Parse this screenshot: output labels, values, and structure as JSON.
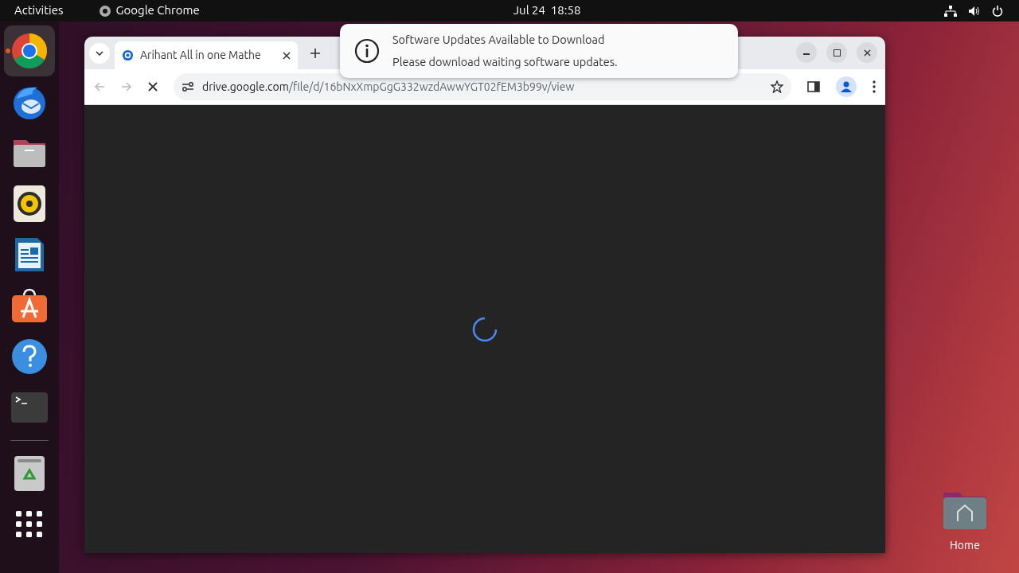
{
  "top_bar": {
    "activities": "Activities",
    "app_name": "Google Chrome",
    "clock": "Jul 24  18:58"
  },
  "dock": {
    "items": [
      {
        "kind": "chrome",
        "running": true
      },
      {
        "kind": "thunderbird",
        "running": false
      },
      {
        "kind": "files",
        "running": false
      },
      {
        "kind": "rhythmbox",
        "running": false
      },
      {
        "kind": "writer",
        "running": false
      },
      {
        "kind": "software",
        "running": false
      },
      {
        "kind": "help",
        "running": false
      },
      {
        "kind": "terminal",
        "running": false
      },
      {
        "kind": "trash",
        "running": false
      },
      {
        "kind": "apps",
        "running": false
      }
    ]
  },
  "browser": {
    "tabs": [
      {
        "title": "Arihant All in one Mathe",
        "selected": true
      }
    ],
    "url_host": "drive.google.com",
    "url_path": "/file/d/16bNxXmpGgG332wzdAwwYGT02fEM3b99v/view",
    "loading": true
  },
  "notification": {
    "title": "Software Updates Available to Download",
    "body": "Please download waiting software updates."
  },
  "desktop_icons": [
    {
      "label": "Home"
    }
  ]
}
